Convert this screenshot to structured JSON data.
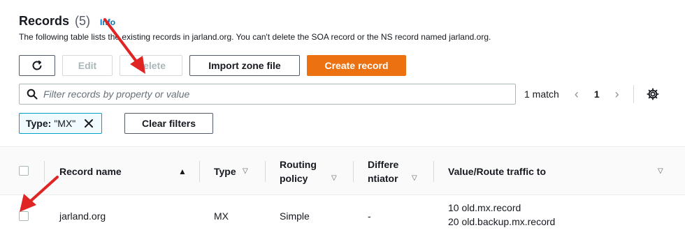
{
  "header": {
    "title": "Records",
    "count": "(5)",
    "info": "Info",
    "description": "The following table lists the existing records in jarland.org. You can't delete the SOA record or the NS record named jarland.org."
  },
  "toolbar": {
    "refresh_icon": "refresh-icon",
    "edit": "Edit",
    "delete": "Delete",
    "import": "Import zone file",
    "create": "Create record"
  },
  "filter": {
    "placeholder": "Filter records by property or value",
    "search_icon": "search-icon"
  },
  "pagination": {
    "match": "1 match",
    "page": "1",
    "settings_icon": "gear-icon"
  },
  "active_filter": {
    "key": "Type:",
    "value": "\"MX\"",
    "clear": "Clear filters"
  },
  "table": {
    "columns": {
      "record_name": "Record name",
      "type": "Type",
      "routing_policy_line1": "Routing",
      "routing_policy_line2": "policy",
      "differentiator_line1": "Differe",
      "differentiator_line2": "ntiator",
      "value": "Value/Route traffic to"
    },
    "rows": [
      {
        "record_name": "jarland.org",
        "type": "MX",
        "routing_policy": "Simple",
        "differentiator": "-",
        "value_line1": "10 old.mx.record",
        "value_line2": "20 old.backup.mx.record"
      }
    ]
  },
  "colors": {
    "primary": "#ec7211",
    "link": "#0073bb",
    "annotation_arrow": "#e02424"
  }
}
